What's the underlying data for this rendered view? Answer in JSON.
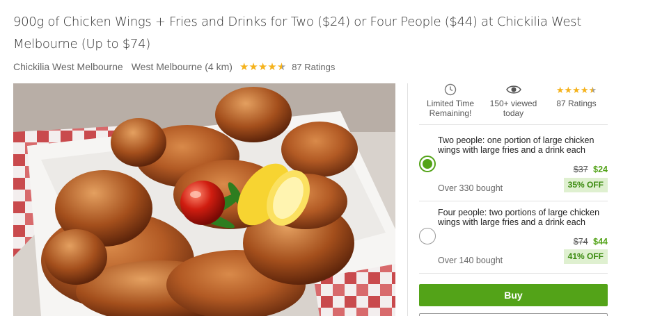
{
  "deal": {
    "title": "900g of Chicken Wings + Fries and Drinks for Two ($24) or Four People ($44) at Chickilia West Melbourne (Up to $74)",
    "merchant": "Chickilia West Melbourne",
    "location": "West Melbourne (4 km)",
    "rating_stars": 4.5,
    "rating_count": "87 Ratings",
    "image": {
      "icon": "fried-chicken-wings-photo"
    }
  },
  "stats": [
    {
      "icon": "clock-icon",
      "label": "Limited Time Remaining!"
    },
    {
      "icon": "eye-icon",
      "label": "150+ viewed today"
    },
    {
      "icon": "star-rating",
      "label": "87 Ratings"
    }
  ],
  "options": [
    {
      "description": "Two people: one portion of large chicken wings with large fries and a drink each",
      "old_price": "$37",
      "new_price": "$24",
      "bought": "Over 330 bought",
      "discount": "35% OFF",
      "selected": true
    },
    {
      "description": "Four people: two portions of large chicken wings with large fries and a drink each",
      "old_price": "$74",
      "new_price": "$44",
      "bought": "Over 140 bought",
      "discount": "41% OFF",
      "selected": false
    }
  ],
  "buy_label": "Buy",
  "colors": {
    "accent": "#53a318",
    "star": "#f5b21b",
    "discount_bg": "#dff0d0"
  }
}
